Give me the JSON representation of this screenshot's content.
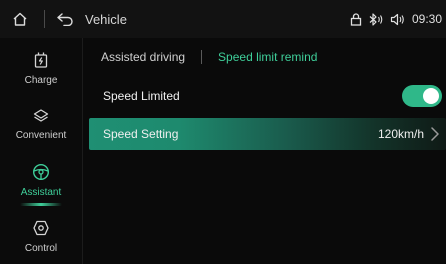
{
  "statusbar": {
    "title": "Vehicle",
    "time": "09:30",
    "icons": [
      "home-icon",
      "back-icon",
      "lock-icon",
      "bluetooth-icon",
      "volume-icon"
    ]
  },
  "sidebar": {
    "items": [
      {
        "label": "Charge",
        "icon": "charge-icon",
        "active": false
      },
      {
        "label": "Convenient",
        "icon": "convenient-icon",
        "active": false
      },
      {
        "label": "Assistant",
        "icon": "steering-wheel-icon",
        "active": true
      },
      {
        "label": "Control",
        "icon": "control-icon",
        "active": false
      }
    ]
  },
  "tabs": [
    {
      "label": "Assisted driving",
      "active": false
    },
    {
      "label": "Speed limit remind",
      "active": true
    }
  ],
  "settings": {
    "speed_limited": {
      "label": "Speed Limited",
      "enabled": true
    },
    "speed_setting": {
      "label": "Speed Setting",
      "value": "120km/h"
    }
  },
  "colors": {
    "accent": "#3fcf9a",
    "toggle_on": "#2fb889",
    "row_highlight": "#1f8f73"
  }
}
